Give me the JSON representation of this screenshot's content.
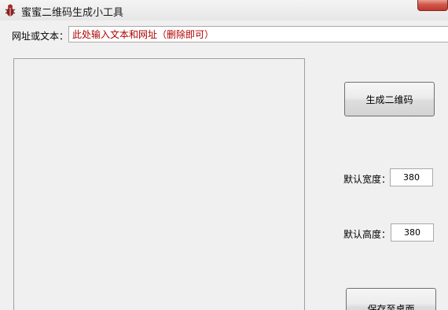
{
  "window": {
    "title": "蜜蜜二维码生成小工具",
    "icon": "app-bug-icon"
  },
  "form": {
    "url_label": "网址或文本：",
    "url_value": "此处输入文本和网址（删除即可）",
    "generate_label": "生成二维码",
    "width_label": "默认宽度：",
    "width_value": "380",
    "height_label": "默认高度：",
    "height_value": "380",
    "save_label": "保存至桌面"
  },
  "colors": {
    "input_text": "#b00000",
    "close_button": "#c2392c"
  }
}
